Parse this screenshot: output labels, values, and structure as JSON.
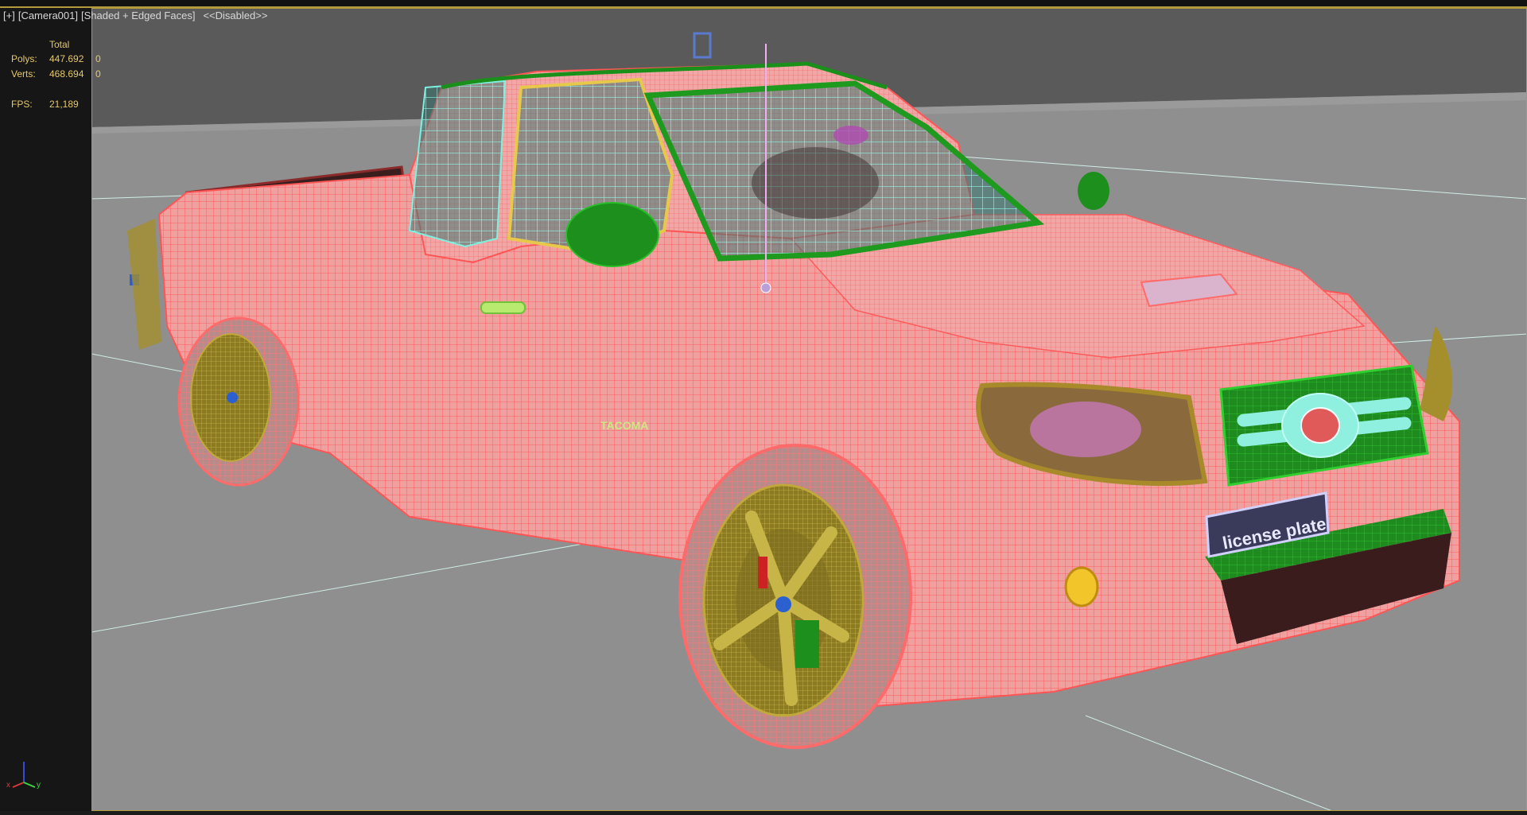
{
  "viewport": {
    "label_plus": "[+]",
    "label_camera": "[Camera001]",
    "label_mode": "[Shaded + Edged Faces]",
    "label_disabled": "<<Disabled>>"
  },
  "stats": {
    "header": "Total",
    "polys_label": "Polys:",
    "polys_total": "447.692",
    "polys_selected": "0",
    "verts_label": "Verts:",
    "verts_total": "468.694",
    "verts_selected": "0",
    "fps_label": "FPS:",
    "fps_value": "21,189"
  },
  "gizmo": {
    "x_label": "x",
    "y_label": "y"
  },
  "scene": {
    "badge_text": "TACOMA",
    "plate_text": "license plate"
  },
  "colors": {
    "accent_border": "#b39a3c",
    "background": "#595959",
    "ground": "#8f8f8f",
    "wire": "#ff7b7b",
    "body": "#f0a2a2",
    "glass": "#7fe8d6",
    "trim": "#1d8a1d",
    "wheel": "#a48f2c"
  }
}
